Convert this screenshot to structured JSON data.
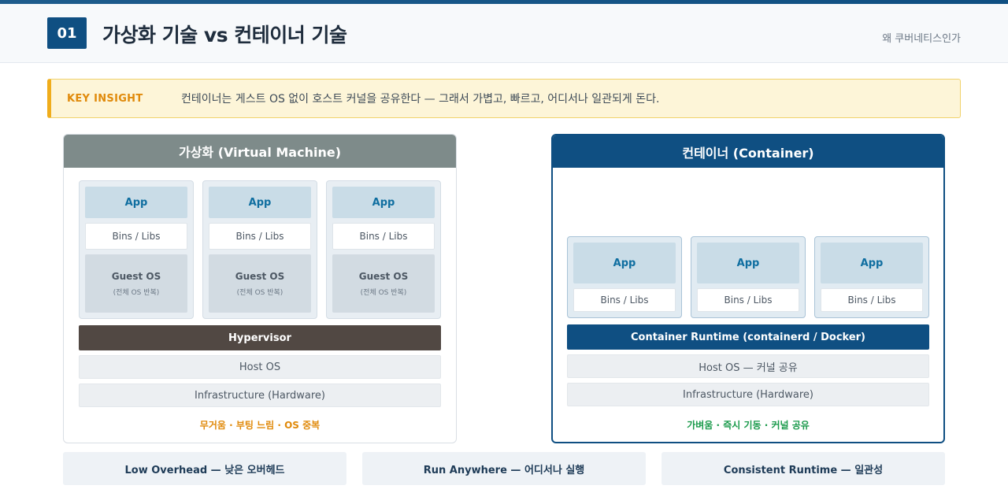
{
  "header": {
    "number": "01",
    "title": "가상화 기술 vs 컨테이너 기술",
    "subtitle": "왜 쿠버네티스인가"
  },
  "insight": {
    "label": "KEY INSIGHT",
    "text": "컨테이너는 게스트 OS 없이 호스트 커널을 공유한다 — 그래서 가볍고, 빠르고, 어디서나 일관되게 돈다."
  },
  "vm": {
    "title": "가상화 (Virtual Machine)",
    "stacks": [
      {
        "app": "App",
        "bins": "Bins / Libs",
        "guest": "Guest OS",
        "guest_note": "(전체 OS 반복)"
      },
      {
        "app": "App",
        "bins": "Bins / Libs",
        "guest": "Guest OS",
        "guest_note": "(전체 OS 반복)"
      },
      {
        "app": "App",
        "bins": "Bins / Libs",
        "guest": "Guest OS",
        "guest_note": "(전체 OS 반복)"
      }
    ],
    "hypervisor": "Hypervisor",
    "host_os": "Host OS",
    "infra": "Infrastructure (Hardware)",
    "note": "무거움 · 부팅 느림 · OS 중복"
  },
  "container": {
    "title": "컨테이너 (Container)",
    "stacks": [
      {
        "app": "App",
        "bins": "Bins / Libs"
      },
      {
        "app": "App",
        "bins": "Bins / Libs"
      },
      {
        "app": "App",
        "bins": "Bins / Libs"
      }
    ],
    "runtime": "Container Runtime (containerd / Docker)",
    "host_os": "Host OS — 커널 공유",
    "infra": "Infrastructure (Hardware)",
    "note": "가벼움 · 즉시 기동 · 커널 공유"
  },
  "features": [
    "Low Overhead — 낮은 오버헤드",
    "Run Anywhere — 어디서나 실행",
    "Consistent Runtime — 일관성"
  ],
  "colors": {
    "primary": "#0f4f82",
    "accent": "#f0ad1c",
    "vm_header": "#7e8b8a",
    "hypervisor": "#514843",
    "warn": "#e08a0b",
    "good": "#1a9a4b"
  }
}
